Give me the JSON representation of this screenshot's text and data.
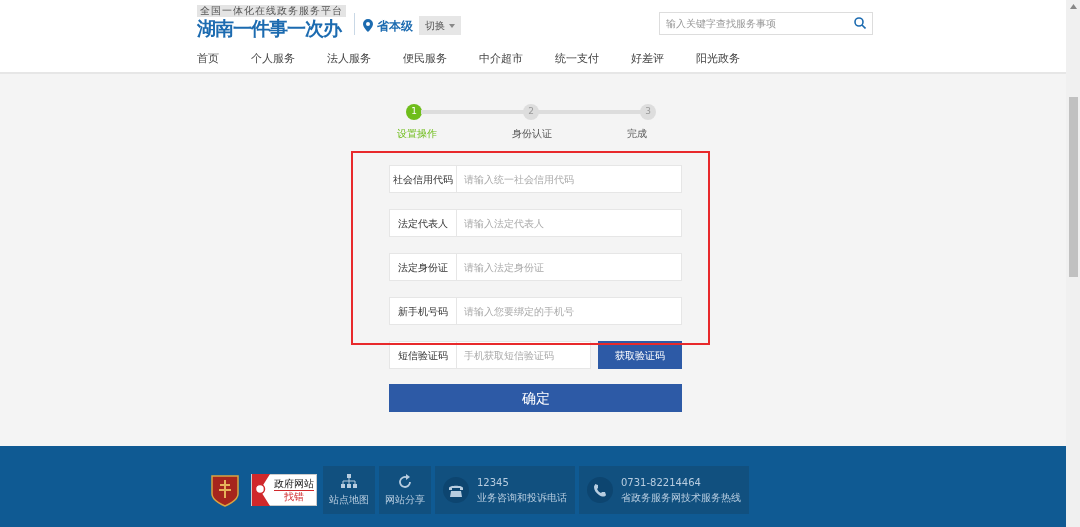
{
  "header": {
    "tagline": "全国一体化在线政务服务平台",
    "logo_text": "湖南一件事一次办",
    "region": "省本级",
    "switch_button": "切换",
    "search": {
      "placeholder": "输入关键字查找服务事项"
    }
  },
  "nav": [
    {
      "label": "首页",
      "selected": false
    },
    {
      "label": "个人服务",
      "selected": false
    },
    {
      "label": "法人服务",
      "selected": false
    },
    {
      "label": "便民服务",
      "selected": false
    },
    {
      "label": "中介超市",
      "selected": false
    },
    {
      "label": "统一支付",
      "selected": false
    },
    {
      "label": "好差评",
      "selected": false
    },
    {
      "label": "阳光政务",
      "selected": false
    }
  ],
  "steps": [
    {
      "number": "1",
      "label": "设置操作",
      "selected": true
    },
    {
      "number": "2",
      "label": "身份认证",
      "selected": false
    },
    {
      "number": "3",
      "label": "完成",
      "selected": false
    }
  ],
  "fields": [
    {
      "label": "社会信用代码",
      "placeholder": "请输入统一社会信用代码",
      "highlighted": true
    },
    {
      "label": "法定代表人",
      "placeholder": "请输入法定代表人",
      "highlighted": true
    },
    {
      "label": "法定身份证",
      "placeholder": "请输入法定身份证",
      "highlighted": true
    },
    {
      "label": "新手机号码",
      "placeholder": "请输入您要绑定的手机号",
      "highlighted": true
    }
  ],
  "sms": {
    "label": "短信验证码",
    "placeholder": "手机获取短信验证码",
    "button": "获取验证码"
  },
  "submit_button": "确定",
  "footer": {
    "error_badge": {
      "title": "政府网站",
      "subtitle": "找错"
    },
    "links": [
      {
        "kind": "sitemap",
        "label": "站点地图"
      },
      {
        "kind": "share",
        "label": "网站分享"
      }
    ],
    "hotlines": [
      {
        "kind": "phone",
        "number": "12345",
        "label": "业务咨询和投诉电话"
      },
      {
        "kind": "call",
        "number": "0731-82214464",
        "label": "省政务服务网技术服务热线"
      }
    ]
  }
}
